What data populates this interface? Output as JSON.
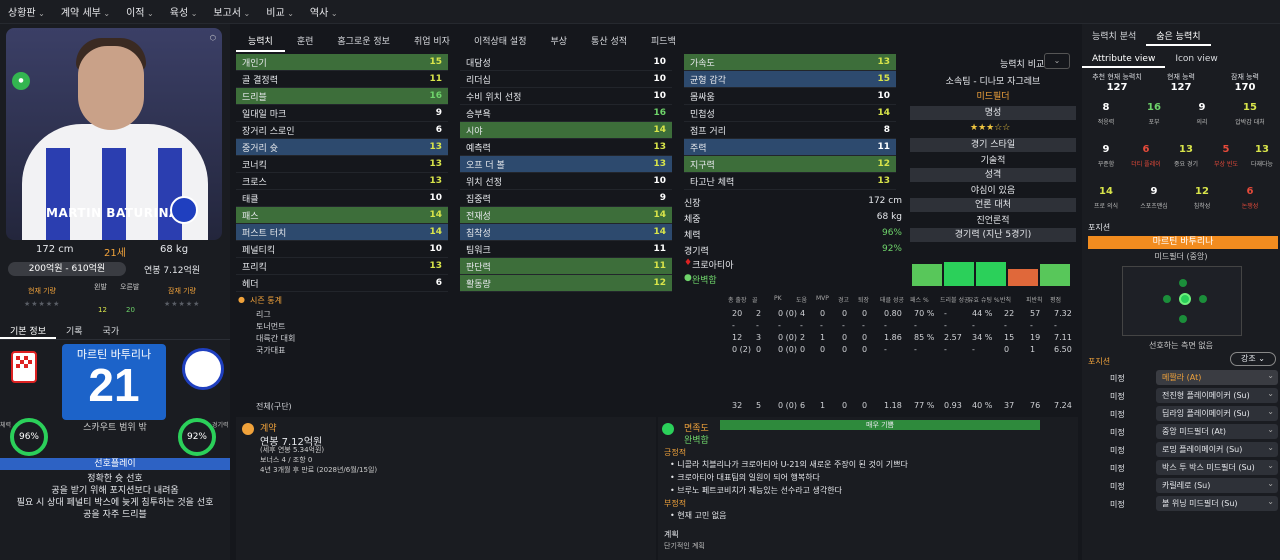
{
  "topnav": [
    "상황판",
    "계약 세부",
    "이적",
    "육성",
    "보고서",
    "비교",
    "역사"
  ],
  "player": {
    "name_plate": "MARTIN BATURINA",
    "height": "172 cm",
    "age": "21세",
    "weight": "68 kg",
    "value": "200억원 - 610억원",
    "wage": "연봉 7.12억원",
    "current_label": "현재 기량",
    "potential_label": "잠재 기량",
    "left_foot_label": "왼발",
    "right_foot_label": "오른발",
    "left_foot": "12",
    "right_foot": "20",
    "kor_name": "마르틴 바투리나",
    "number": "21",
    "scout": "스카우트 범위 밖",
    "cond_label": "체력",
    "cond": "96%",
    "sharp_label": "경기력",
    "sharp": "92%"
  },
  "left_tabs": [
    "기본 정보",
    "기록",
    "국가"
  ],
  "playstyle": {
    "title": "선호플레이",
    "lines": [
      "정확한 슛 선호",
      "공을 받기 위해 포지션보다 내려옴",
      "필요 시 상대 페널티 박스에 늦게 침투하는 것을 선호",
      "공을 자주 드리블"
    ]
  },
  "mid_tabs": [
    "능력치",
    "훈련",
    "홈그로운 정보",
    "취업 비자",
    "이적상태 설정",
    "부상",
    "통산 성적",
    "피드백"
  ],
  "attr_col1": [
    [
      "개인기",
      "15",
      "y",
      "hl-g"
    ],
    [
      "골 결정력",
      "11",
      "y",
      ""
    ],
    [
      "드리블",
      "16",
      "g",
      "hl-g"
    ],
    [
      "일대일 마크",
      "9",
      "w",
      ""
    ],
    [
      "장거리 스로인",
      "6",
      "w",
      ""
    ],
    [
      "중거리 슛",
      "13",
      "y",
      "hl"
    ],
    [
      "코너킥",
      "13",
      "y",
      ""
    ],
    [
      "크로스",
      "13",
      "y",
      ""
    ],
    [
      "태클",
      "10",
      "w",
      ""
    ],
    [
      "패스",
      "14",
      "y",
      "hl-g"
    ],
    [
      "퍼스트 터치",
      "14",
      "y",
      "hl"
    ],
    [
      "페널티킥",
      "10",
      "w",
      ""
    ],
    [
      "프리킥",
      "13",
      "y",
      ""
    ],
    [
      "헤더",
      "6",
      "w",
      ""
    ]
  ],
  "attr_col2": [
    [
      "대담성",
      "10",
      "w",
      ""
    ],
    [
      "리더십",
      "10",
      "w",
      ""
    ],
    [
      "수비 위치 선정",
      "10",
      "w",
      ""
    ],
    [
      "승부욕",
      "16",
      "g",
      ""
    ],
    [
      "시야",
      "14",
      "y",
      "hl-g"
    ],
    [
      "예측력",
      "13",
      "y",
      ""
    ],
    [
      "오프 더 볼",
      "13",
      "y",
      "hl"
    ],
    [
      "위치 선정",
      "10",
      "w",
      ""
    ],
    [
      "집중력",
      "9",
      "w",
      ""
    ],
    [
      "전재성",
      "14",
      "y",
      "hl-g"
    ],
    [
      "침착성",
      "14",
      "y",
      "hl"
    ],
    [
      "팀워크",
      "11",
      "w",
      ""
    ],
    [
      "판단력",
      "11",
      "y",
      "hl-g"
    ],
    [
      "활동량",
      "12",
      "y",
      "hl-g"
    ]
  ],
  "attr_col3": [
    [
      "가속도",
      "13",
      "y",
      "hl-g"
    ],
    [
      "균형 감각",
      "15",
      "y",
      "hl"
    ],
    [
      "몸싸움",
      "10",
      "w",
      ""
    ],
    [
      "민첩성",
      "14",
      "y",
      ""
    ],
    [
      "점프 거리",
      "8",
      "w",
      ""
    ],
    [
      "주력",
      "11",
      "w",
      "hl"
    ],
    [
      "지구력",
      "12",
      "y",
      "hl-g"
    ],
    [
      "타고난 체력",
      "13",
      "y",
      ""
    ]
  ],
  "compare": {
    "label": "능력치 비교",
    "club_line": "소속팀 - 디나모 자그레브",
    "role": "미드필더",
    "fame_label": "명성",
    "style_label": "경기 스타일",
    "style": "기술적",
    "personality_label": "성격",
    "personality": "야심이 있음",
    "media_label": "언론 대처",
    "media": "진언론적",
    "form_label": "경기력 (지난 5경기)"
  },
  "bio": [
    [
      "신장",
      "172 cm"
    ],
    [
      "체중",
      "68 kg"
    ],
    [
      "체력",
      "96%"
    ],
    [
      "경기력",
      "92%"
    ]
  ],
  "bio_nation": "크로아티아",
  "bio_fit": "완벽함",
  "season": {
    "title": "시즌 통계",
    "headers": [
      "총 출장",
      "골",
      "PK",
      "도움",
      "MVP",
      "경고",
      "퇴장",
      "태클 성공",
      "패스 %",
      "드리블 성공",
      "유효 슈팅 %",
      "반칙",
      "피반칙",
      "평점"
    ],
    "rows": [
      [
        "리그",
        "20",
        "2",
        "0 (0)",
        "4",
        "0",
        "0",
        "0",
        "0.80",
        "70 %",
        "-",
        "44 %",
        "22",
        "57",
        "7.32"
      ],
      [
        "토너먼트",
        "-",
        "-",
        "-",
        "-",
        "-",
        "-",
        "-",
        "-",
        "-",
        "-",
        "-",
        "-",
        "-",
        "-"
      ],
      [
        "대륙간 대회",
        "12",
        "3",
        "0 (0)",
        "2",
        "1",
        "0",
        "0",
        "1.86",
        "85 %",
        "2.57",
        "34 %",
        "15",
        "19",
        "7.11"
      ],
      [
        "국가대표",
        "0 (2)",
        "0",
        "0 (0)",
        "0",
        "0",
        "0",
        "0",
        "-",
        "-",
        "-",
        "-",
        "0",
        "1",
        "6.50"
      ]
    ],
    "total": [
      "전체(구단)",
      "32",
      "5",
      "0 (0)",
      "6",
      "1",
      "0",
      "0",
      "1.18",
      "77 %",
      "0.93",
      "40 %",
      "37",
      "76",
      "7.24"
    ]
  },
  "contract": {
    "title": "계약",
    "wage": "연봉 7.12억원",
    "lines": [
      "(세후 연봉 5.34억원)",
      "보너스 4 / 조항 0",
      "4년 3개월 후 만료 (2028년/6월/15일)"
    ]
  },
  "mood": {
    "title": "면족도",
    "bar": "매우 기쁨",
    "status": "완벽함",
    "pos_label": "긍정적",
    "pos": [
      "니콜라 치블리나가 크로아티아 U-21의 새로운 주장이 된 것이 기쁘다",
      "크로아티아 대표팀의 일원이 되어 행복하다",
      "브루노 페트코비치가 재능있는 선수라고 생각한다"
    ],
    "neg_label": "부정적",
    "neg": [
      "현재 고민 없음"
    ],
    "plan_label": "계획",
    "plan_sub": "단기적인 계획"
  },
  "right": {
    "tabs": [
      "능력치 분석",
      "숨은 능력치"
    ],
    "subtabs": [
      "Attribute view",
      "Icon view"
    ],
    "ca": [
      [
        "추천 현재 능력치",
        "127"
      ],
      [
        "현재 능력",
        "127"
      ],
      [
        "잠재 능력",
        "170"
      ]
    ],
    "hidden": [
      [
        "8",
        "적응력",
        "w"
      ],
      [
        "16",
        "포부",
        "g"
      ],
      [
        "9",
        "의리",
        "w"
      ],
      [
        "15",
        "압박감 대처",
        "y"
      ],
      [
        "9",
        "꾸준함",
        "w"
      ],
      [
        "6",
        "더티 플레이",
        "r"
      ],
      [
        "13",
        "중요 경기",
        "y"
      ],
      [
        "5",
        "부상 빈도",
        "r"
      ],
      [
        "13",
        "다재다능",
        "y"
      ],
      [
        "14",
        "프로 의식",
        "y"
      ],
      [
        "9",
        "스포츠맨십",
        "w"
      ],
      [
        "12",
        "침착성",
        "y"
      ],
      [
        "6",
        "논쟁성",
        "r"
      ]
    ],
    "pos_title": "포지션",
    "pos_bar": "마르틴 바투리나",
    "pos_sub": "미드필더 (중앙)",
    "pos_note": "선호하는 측면 없음",
    "roles_title": "포지션",
    "sort": "강조",
    "roles": [
      [
        "미정",
        "메짤라 (At)"
      ],
      [
        "미정",
        "전진형 플레이메이커 (Su)"
      ],
      [
        "미정",
        "딥라잉 플레이메이커 (Su)"
      ],
      [
        "미정",
        "중앙 미드필더 (At)"
      ],
      [
        "미정",
        "로밍 플레이메이커 (Su)"
      ],
      [
        "미정",
        "박스 투 박스 미드필더 (Su)"
      ],
      [
        "미정",
        "카릴레로 (Su)"
      ],
      [
        "미정",
        "볼 위닝 미드필더 (Su)"
      ]
    ]
  },
  "colors": {
    "accent": "#f28c1f",
    "green": "#2bd05a",
    "blue": "#2d62c4"
  }
}
